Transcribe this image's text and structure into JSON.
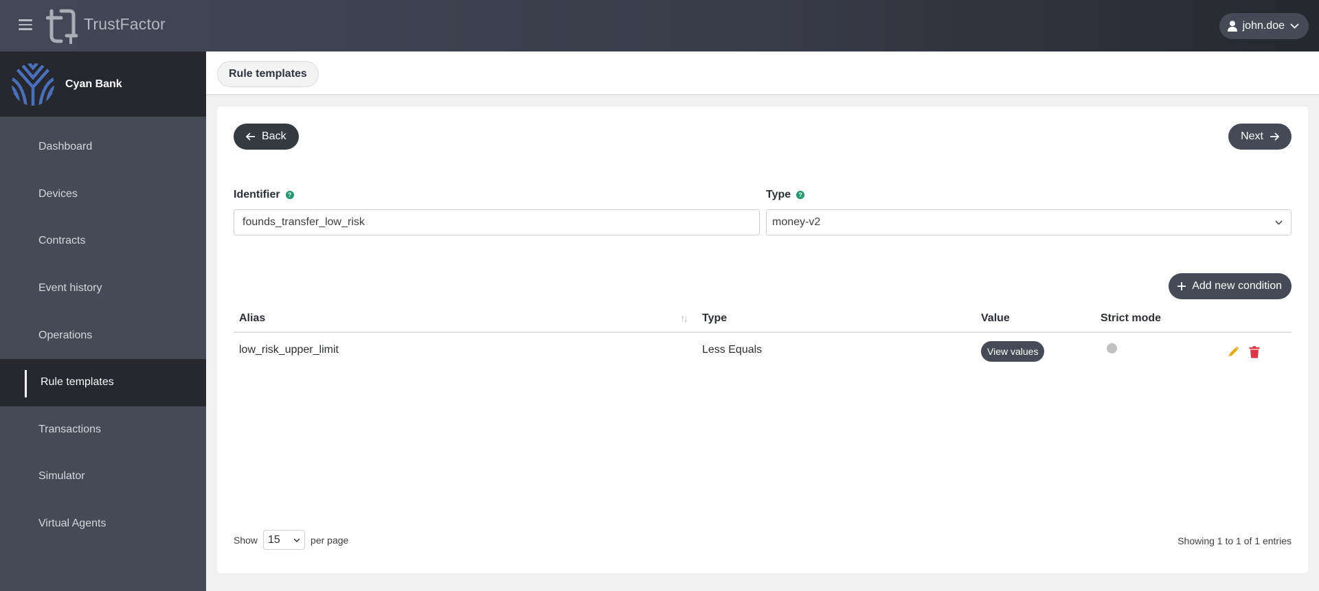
{
  "app": {
    "name": "TrustFactor",
    "user": "john.doe"
  },
  "organization": {
    "name": "Cyan Bank",
    "logo_color": "#4a6fbd"
  },
  "sidebar": {
    "items": [
      {
        "label": "Dashboard",
        "active": false
      },
      {
        "label": "Devices",
        "active": false
      },
      {
        "label": "Contracts",
        "active": false
      },
      {
        "label": "Event history",
        "active": false
      },
      {
        "label": "Operations",
        "active": false
      },
      {
        "label": "Rule templates",
        "active": true
      },
      {
        "label": "Transactions",
        "active": false
      },
      {
        "label": "Simulator",
        "active": false
      },
      {
        "label": "Virtual Agents",
        "active": false
      }
    ]
  },
  "breadcrumb": {
    "current": "Rule templates"
  },
  "actions": {
    "back_label": "Back",
    "next_label": "Next",
    "add_condition_label": "Add new condition"
  },
  "form": {
    "identifier": {
      "label": "Identifier",
      "value": "founds_transfer_low_risk"
    },
    "type": {
      "label": "Type",
      "value": "money-v2"
    }
  },
  "table": {
    "headers": {
      "alias": "Alias",
      "type": "Type",
      "value": "Value",
      "strict_mode": "Strict mode"
    },
    "rows": [
      {
        "alias": "low_risk_upper_limit",
        "type": "Less Equals",
        "value_button": "View values",
        "strict_mode": false
      }
    ]
  },
  "pagination": {
    "show_label": "Show",
    "per_page_value": "15",
    "per_page_label": "per page",
    "summary": "Showing 1 to 1 of 1 entries"
  },
  "colors": {
    "help_icon": "#1e9a6c",
    "edit_icon": "#e6ab0a",
    "delete_icon": "#dc3545",
    "button_dark": "#464a57"
  }
}
